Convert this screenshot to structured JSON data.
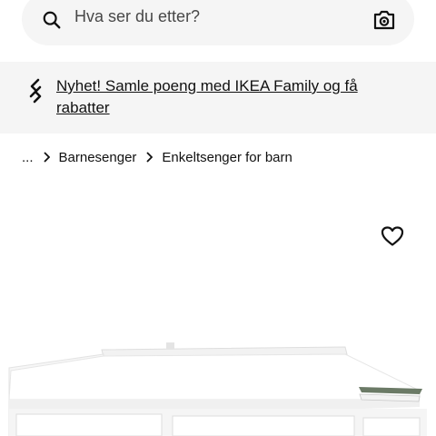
{
  "search": {
    "placeholder": "Hva ser du etter?"
  },
  "promo": {
    "text": "Nyhet! Samle poeng med IKEA Family og få rabatter"
  },
  "breadcrumb": {
    "ellipsis": "...",
    "items": [
      "Barnesenger",
      "Enkeltsenger for barn"
    ]
  },
  "icons": {
    "search": "search-icon",
    "camera": "camera-icon",
    "promo": "family-card-icon",
    "separator": "chevron-right-icon",
    "wishlist": "heart-icon"
  },
  "colors": {
    "surface": "#f5f5f5",
    "text": "#111111"
  }
}
